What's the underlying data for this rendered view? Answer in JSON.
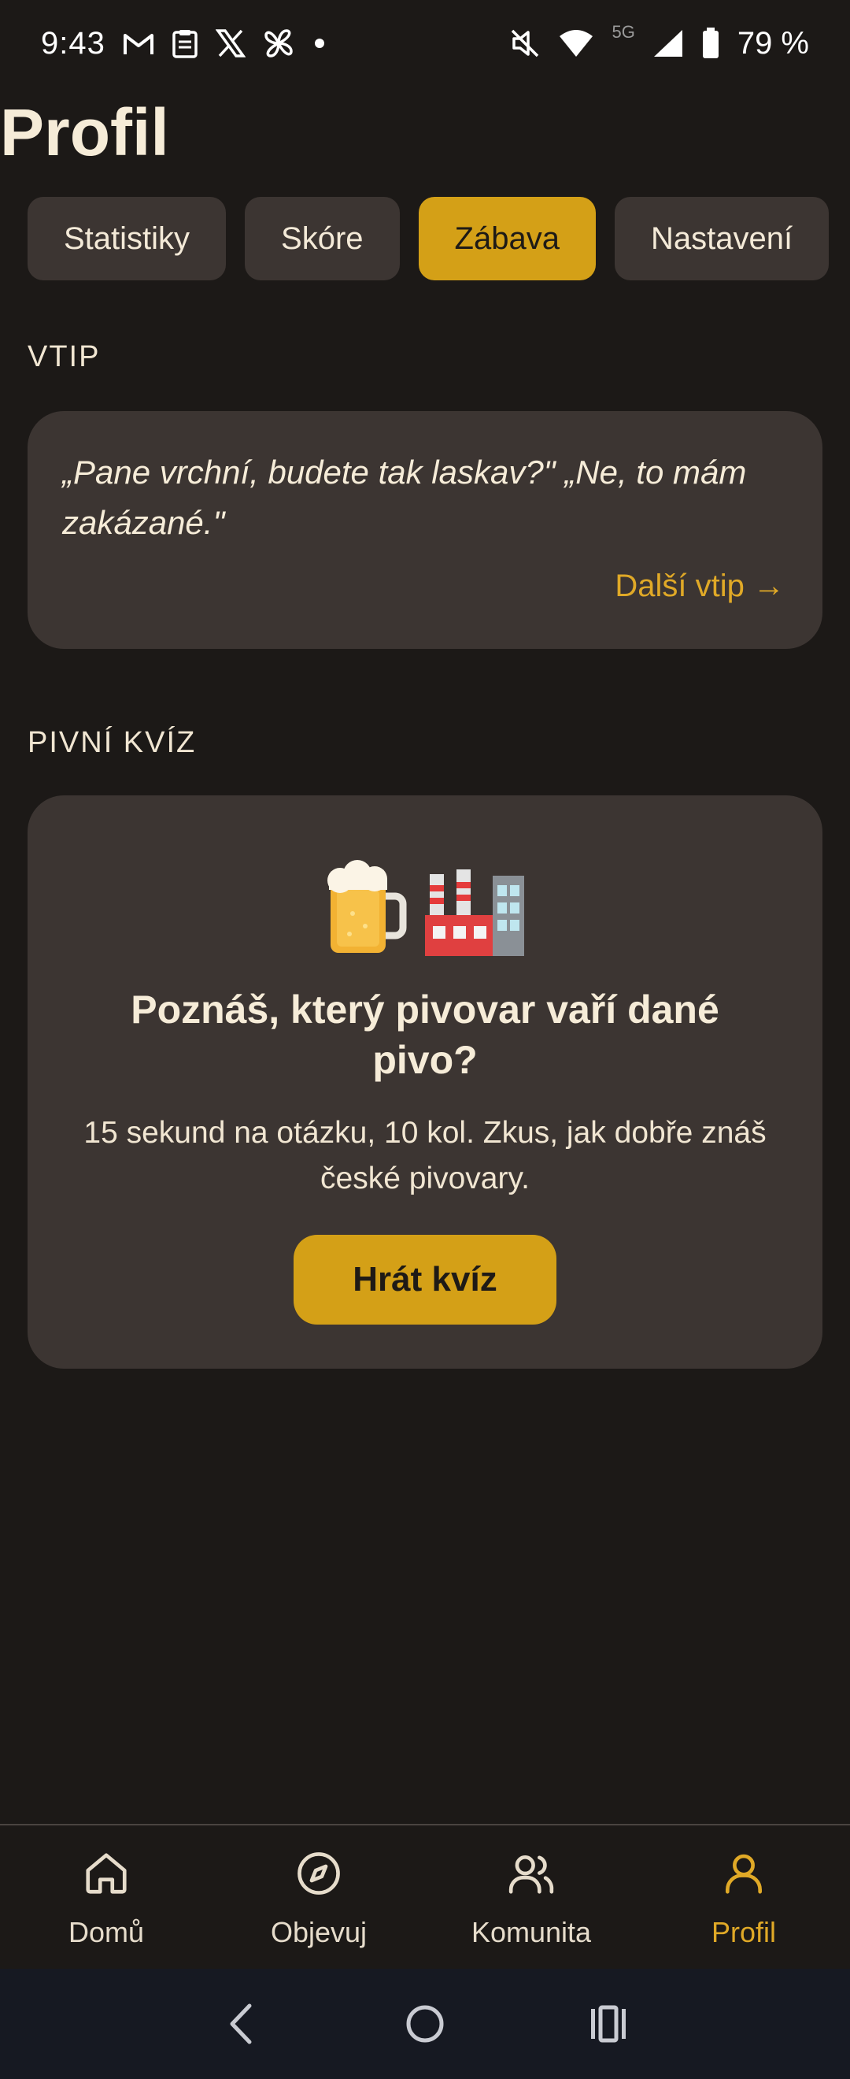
{
  "status_bar": {
    "time": "9:43",
    "network_label": "5G",
    "battery_percent": "79 %",
    "icons": [
      "gmail-icon",
      "clipboard-icon",
      "x-icon",
      "pinwheel-icon",
      "dot-icon",
      "mute-icon",
      "wifi-icon",
      "signal-icon",
      "battery-icon"
    ]
  },
  "page": {
    "title": "Profil"
  },
  "tabs": [
    {
      "label": "Statistiky",
      "active": false
    },
    {
      "label": "Skóre",
      "active": false
    },
    {
      "label": "Zábava",
      "active": true
    },
    {
      "label": "Nastavení",
      "active": false
    }
  ],
  "joke": {
    "section_label": "VTIP",
    "text": "„Pane vrchní, budete tak laskav?\" „Ne, to mám zakázané.\"",
    "next_label": "Další vtip →"
  },
  "quiz": {
    "section_label": "PIVNÍ KVÍZ",
    "emoji": "🍺🏭",
    "title": "Poznáš, který pivovar vaří dané pivo?",
    "description": "15 sekund na otázku, 10 kol. Zkus, jak dobře znáš české pivovary.",
    "button_label": "Hrát kvíz"
  },
  "bottom_nav": [
    {
      "label": "Domů",
      "icon": "home-icon",
      "active": false
    },
    {
      "label": "Objevuj",
      "icon": "compass-icon",
      "active": false
    },
    {
      "label": "Komunita",
      "icon": "users-icon",
      "active": false
    },
    {
      "label": "Profil",
      "icon": "user-icon",
      "active": true
    }
  ],
  "colors": {
    "background": "#1c1917",
    "card": "#3c3532",
    "accent": "#d4a017",
    "accent_text": "#e0a927",
    "text": "#f6ecd8"
  }
}
